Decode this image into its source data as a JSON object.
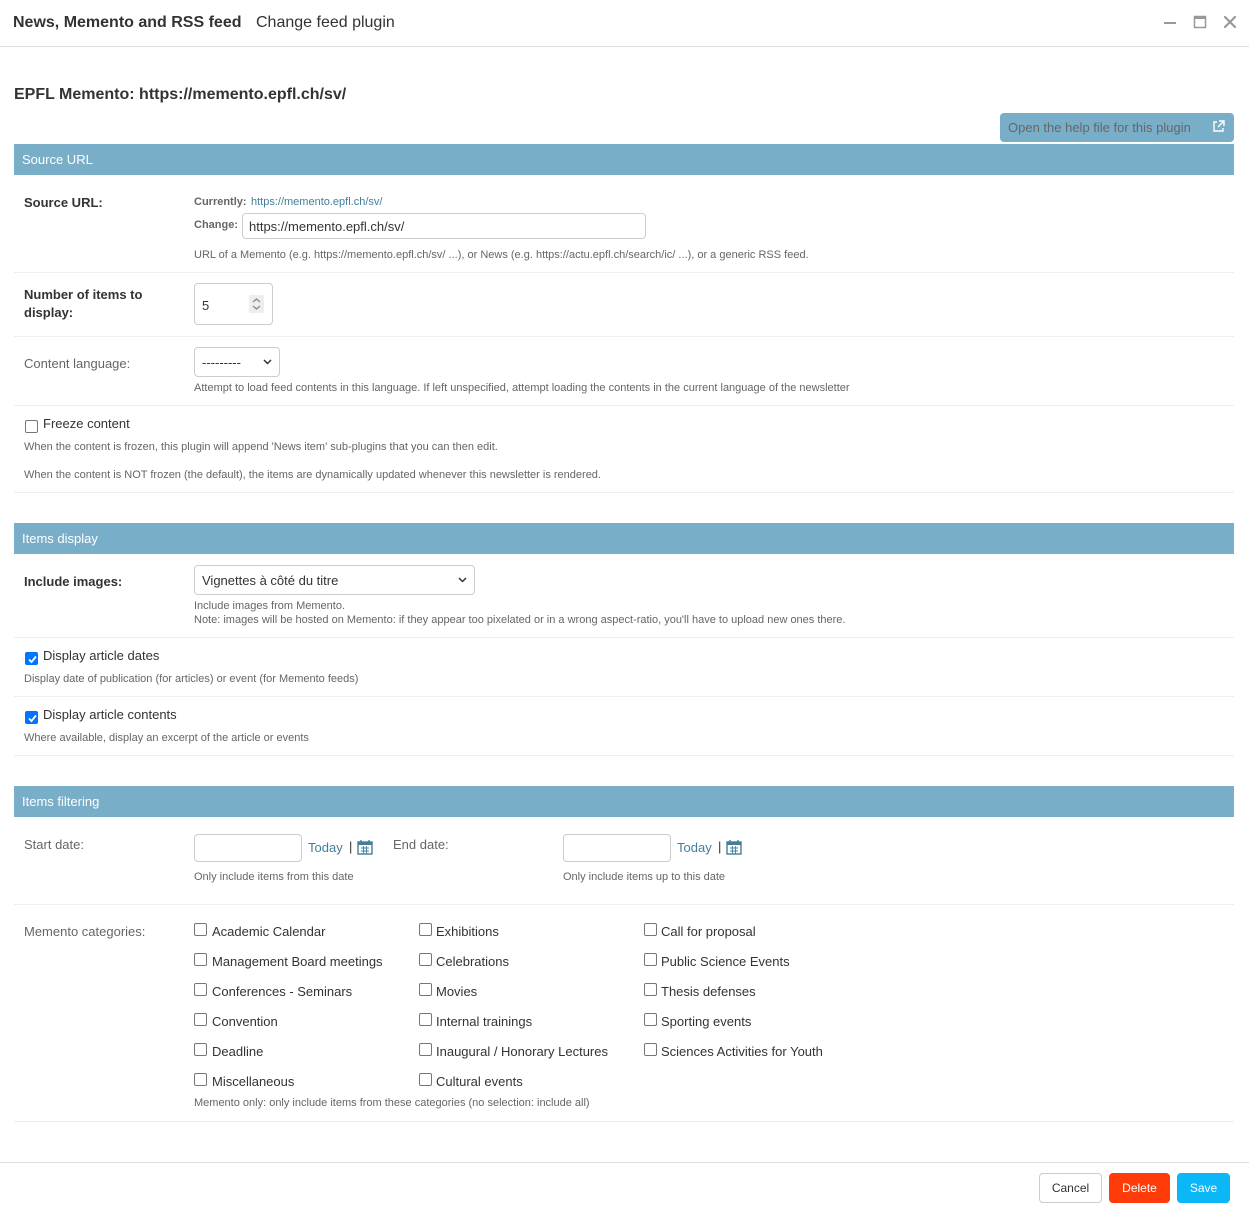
{
  "window": {
    "title": "News, Memento and RSS feed",
    "subtitle": "Change feed plugin"
  },
  "plugin_title": "EPFL Memento: https://memento.epfl.ch/sv/",
  "help_button": "Open the help file for this plugin",
  "sections": {
    "source": "Source URL",
    "display": "Items display",
    "filtering": "Items filtering"
  },
  "source_url": {
    "label": "Source URL:",
    "currently_label": "Currently:",
    "currently_value": "https://memento.epfl.ch/sv/",
    "change_label": "Change:",
    "change_value": "https://memento.epfl.ch/sv/",
    "help": "URL of a Memento (e.g. https://memento.epfl.ch/sv/ ...), or News (e.g. https://actu.epfl.ch/search/ic/ ...), or a generic RSS feed."
  },
  "num_items": {
    "label_line1": "Number of items to",
    "label_line2": "display:",
    "value": "5"
  },
  "content_language": {
    "label": "Content language:",
    "value": "---------",
    "help": "Attempt to load feed contents in this language. If left unspecified, attempt loading the contents in the current language of the newsletter"
  },
  "freeze": {
    "label": "Freeze content",
    "checked": false,
    "help1": "When the content is frozen, this plugin will append 'News item' sub-plugins that you can then edit.",
    "help2": "When the content is NOT frozen (the default), the items are dynamically updated whenever this newsletter is rendered."
  },
  "include_images": {
    "label": "Include images:",
    "value": "Vignettes à côté du titre",
    "help1": "Include images from Memento.",
    "help2": "Note: images will be hosted on Memento: if they appear too pixelated or in a wrong aspect-ratio, you'll have to upload new ones there."
  },
  "display_dates": {
    "label": "Display article dates",
    "checked": true,
    "help": "Display date of publication (for articles) or event (for Memento feeds)"
  },
  "display_contents": {
    "label": "Display article contents",
    "checked": true,
    "help": "Where available, display an excerpt of the article or events"
  },
  "start_date": {
    "label": "Start date:",
    "value": "",
    "today": "Today",
    "sep": "|",
    "help": "Only include items from this date"
  },
  "end_date": {
    "label": "End date:",
    "value": "",
    "today": "Today",
    "sep": "|",
    "help": "Only include items up to this date"
  },
  "categories": {
    "label": "Memento categories:",
    "columns": [
      [
        "Academic Calendar",
        "Management Board meetings",
        "Conferences - Seminars",
        "Convention",
        "Deadline",
        "Miscellaneous"
      ],
      [
        "Exhibitions",
        "Celebrations",
        "Movies",
        "Internal trainings",
        "Inaugural / Honorary Lectures",
        "Cultural events"
      ],
      [
        "Call for proposal",
        "Public Science Events",
        "Thesis defenses",
        "Sporting events",
        "Sciences Activities for Youth"
      ]
    ],
    "help": "Memento only: only include items from these categories (no selection: include all)"
  },
  "footer": {
    "cancel": "Cancel",
    "delete": "Delete",
    "save": "Save"
  },
  "colors": {
    "section_header": "#79aec8",
    "link": "#447e9b",
    "delete": "#ff3b0a",
    "save": "#0bb7f7",
    "checkbox": "#0075ff"
  },
  "icons": {
    "minimize": "minimize-icon",
    "maximize": "maximize-icon",
    "close": "close-icon",
    "external_link": "external-link-icon",
    "calendar": "calendar-icon",
    "select_chevron": "chevron-down-icon",
    "spinner": "spinner-arrows-icon"
  }
}
